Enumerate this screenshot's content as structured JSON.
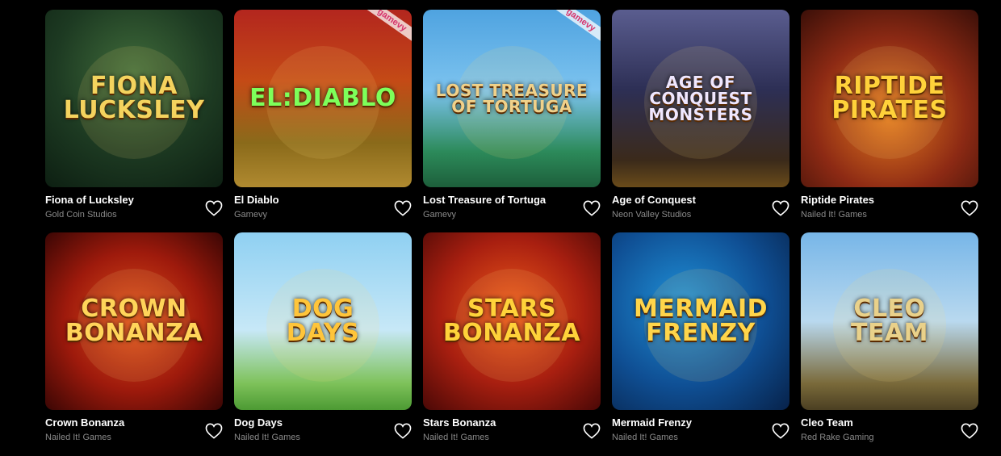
{
  "games": [
    {
      "title": "Fiona of Lucksley",
      "provider": "Gold Coin Studios",
      "logo_line1": "Fiona",
      "logo_line2": "Lucksley",
      "logo_color": "#f4d35e",
      "theme": "t-fiona",
      "ribbon": ""
    },
    {
      "title": "El Diablo",
      "provider": "Gamevy",
      "logo_line1": "El:Diablo",
      "logo_line2": "",
      "logo_color": "#7dff5a",
      "theme": "t-diablo",
      "ribbon": "gamevy"
    },
    {
      "title": "Lost Treasure of Tortuga",
      "provider": "Gamevy",
      "logo_line1": "Lost Treasure",
      "logo_line2": "of Tortuga",
      "logo_color": "#f0d18a",
      "theme": "t-lost",
      "ribbon": "gamevy"
    },
    {
      "title": "Age of Conquest",
      "provider": "Neon Valley Studios",
      "logo_line1": "Age of Conquest",
      "logo_line2": "Monsters",
      "logo_color": "#efe7ff",
      "theme": "t-age",
      "ribbon": ""
    },
    {
      "title": "Riptide Pirates",
      "provider": "Nailed It! Games",
      "logo_line1": "Riptide",
      "logo_line2": "Pirates",
      "logo_color": "#ffd23a",
      "theme": "t-riptide",
      "ribbon": ""
    },
    {
      "title": "Crown Bonanza",
      "provider": "Nailed It! Games",
      "logo_line1": "Crown",
      "logo_line2": "Bonanza",
      "logo_color": "#ffd45a",
      "theme": "t-crown",
      "ribbon": ""
    },
    {
      "title": "Dog Days",
      "provider": "Nailed It! Games",
      "logo_line1": "Dog",
      "logo_line2": "Days",
      "logo_color": "#ffc53a",
      "theme": "t-dog",
      "ribbon": ""
    },
    {
      "title": "Stars Bonanza",
      "provider": "Nailed It! Games",
      "logo_line1": "Stars",
      "logo_line2": "Bonanza",
      "logo_color": "#ffd23a",
      "theme": "t-stars",
      "ribbon": ""
    },
    {
      "title": "Mermaid Frenzy",
      "provider": "Nailed It! Games",
      "logo_line1": "Mermaid",
      "logo_line2": "Frenzy",
      "logo_color": "#ffd54a",
      "theme": "t-mermaid",
      "ribbon": ""
    },
    {
      "title": "Cleo Team",
      "provider": "Red Rake Gaming",
      "logo_line1": "Cleo",
      "logo_line2": "Team",
      "logo_color": "#e9d18a",
      "theme": "t-cleo",
      "ribbon": ""
    }
  ],
  "icons": {
    "favorite": "heart-outline-icon"
  },
  "colors": {
    "background": "#000000",
    "title": "#ffffff",
    "provider": "#8a8a8a"
  }
}
